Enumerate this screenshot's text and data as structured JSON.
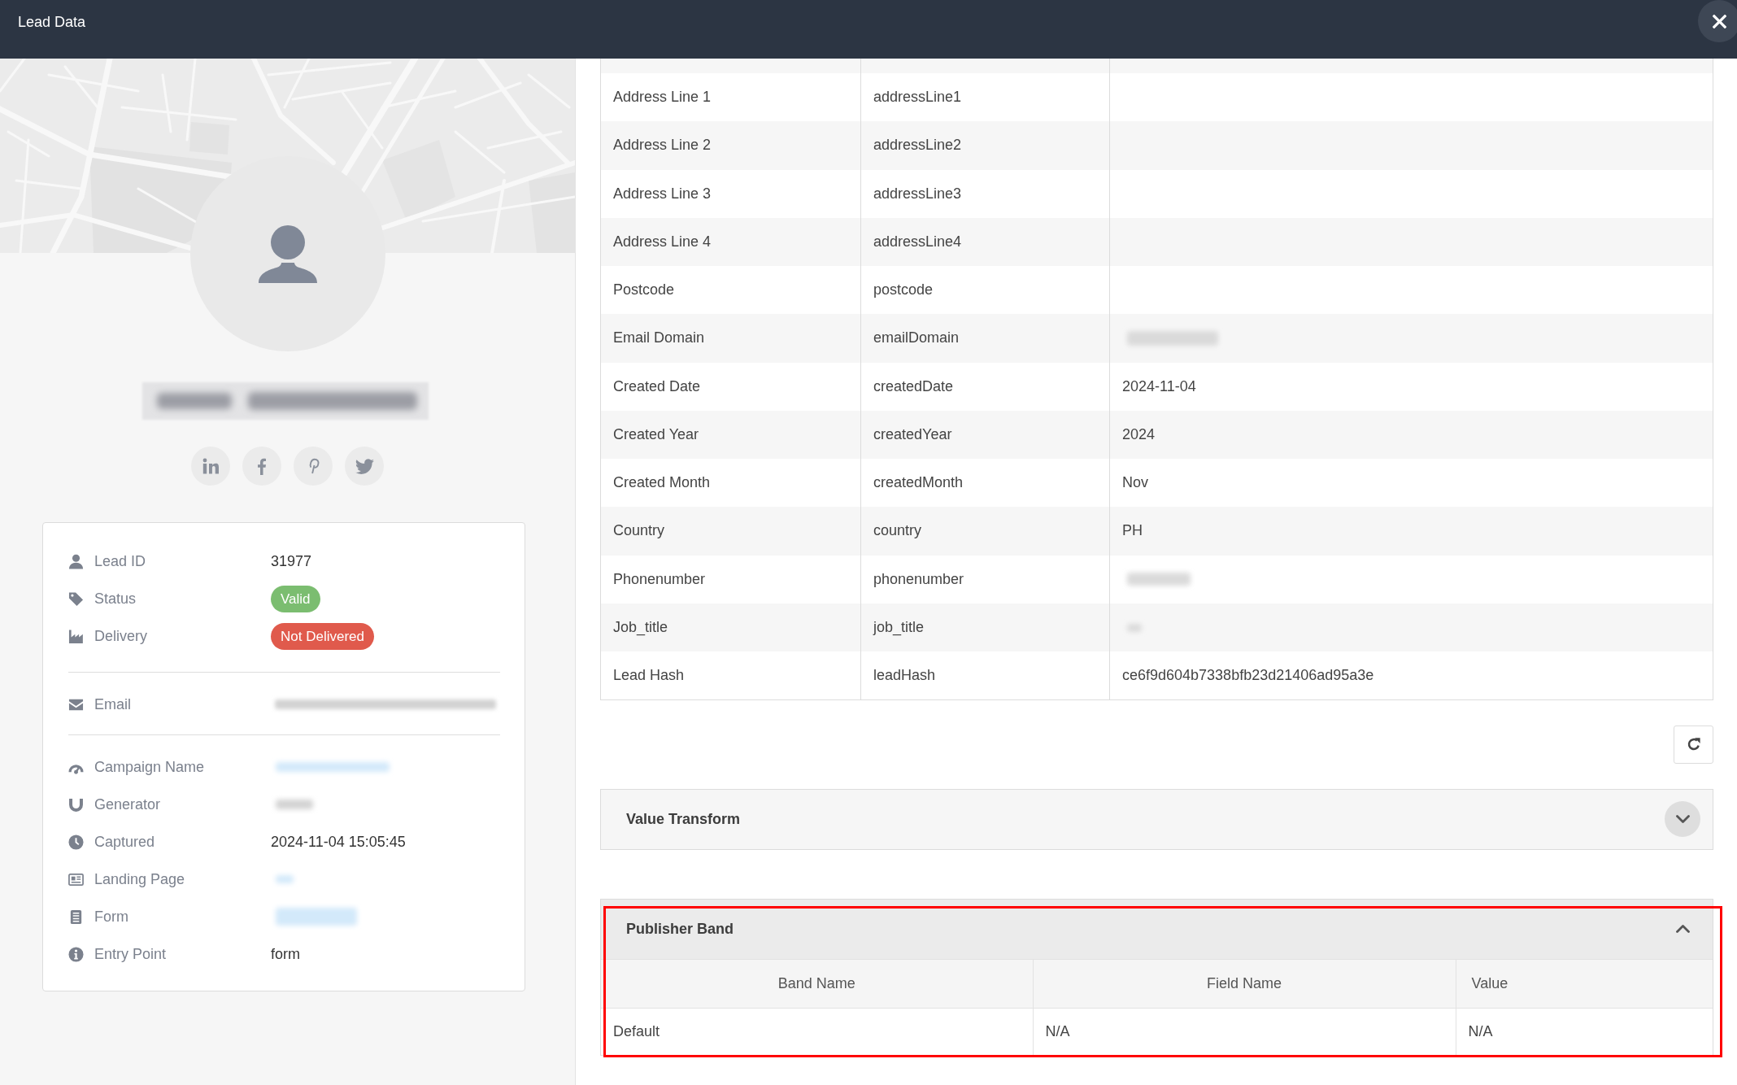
{
  "window": {
    "title": "Lead Data",
    "closable": true
  },
  "profile": {
    "name_redacted": true,
    "social_links": [
      {
        "kind": "linkedin"
      },
      {
        "kind": "facebook"
      },
      {
        "kind": "pinterest"
      },
      {
        "kind": "twitter"
      }
    ]
  },
  "details": [
    {
      "items": [
        {
          "label": "Lead ID",
          "kind": "text",
          "value": "31977"
        },
        {
          "label": "Status",
          "kind": "badge",
          "value": "Valid",
          "color": "#7bbd70"
        },
        {
          "label": "Delivery",
          "kind": "badge",
          "value": "Not Delivered",
          "color": "#e05a4c"
        }
      ]
    },
    {
      "items": [
        {
          "label": "Email",
          "kind": "blurred"
        }
      ]
    },
    {
      "items": [
        {
          "label": "Campaign Name",
          "kind": "blurredlink"
        },
        {
          "label": "Generator",
          "kind": "blurred"
        },
        {
          "label": "Captured",
          "kind": "text",
          "value": "2024-11-04 15:05:45"
        },
        {
          "label": "Landing Page",
          "kind": "blurredlink"
        },
        {
          "label": "Form",
          "kind": "blurredlink"
        },
        {
          "label": "Entry Point",
          "kind": "text",
          "value": "form"
        }
      ]
    }
  ],
  "fields_table": {
    "rows": [
      {
        "field_label": "Address Line 1",
        "field_key": "addressLine1",
        "kind": "text"
      },
      {
        "field_label": "Address Line 2",
        "field_key": "addressLine2",
        "kind": "text"
      },
      {
        "field_label": "Address Line 3",
        "field_key": "addressLine3",
        "kind": "text"
      },
      {
        "field_label": "Address Line 4",
        "field_key": "addressLine4",
        "kind": "text"
      },
      {
        "field_label": "Postcode",
        "field_key": "postcode",
        "kind": "text"
      },
      {
        "field_label": "Email Domain",
        "field_key": "emailDomain",
        "kind": "blurred"
      },
      {
        "field_label": "Created Date",
        "field_key": "createdDate",
        "kind": "text",
        "field_value": "2024-11-04"
      },
      {
        "field_label": "Created Year",
        "field_key": "createdYear",
        "kind": "text",
        "field_value": "2024"
      },
      {
        "field_label": "Created Month",
        "field_key": "createdMonth",
        "kind": "text",
        "field_value": "Nov"
      },
      {
        "field_label": "Country",
        "field_key": "country",
        "kind": "text",
        "field_value": "PH"
      },
      {
        "field_label": "Phonenumber",
        "field_key": "phonenumber",
        "kind": "blurred"
      },
      {
        "field_label": "Job_title",
        "field_key": "job_title",
        "kind": "blurred"
      },
      {
        "field_label": "Lead Hash",
        "field_key": "leadHash",
        "kind": "text",
        "field_value": "ce6f9d604b7338bfb23d21406ad95a3e"
      }
    ],
    "actions": [
      {
        "kind": "refresh"
      }
    ]
  },
  "panels": [
    {
      "title": "Value Transform",
      "expanded": false,
      "highlighted": false
    },
    {
      "title": "Publisher Band",
      "expanded": true,
      "highlighted": true,
      "table": {
        "columns": [
          "Band Name",
          "Field Name",
          "Value"
        ],
        "rows": [
          [
            "Default",
            "N/A",
            "N/A"
          ]
        ]
      }
    }
  ]
}
